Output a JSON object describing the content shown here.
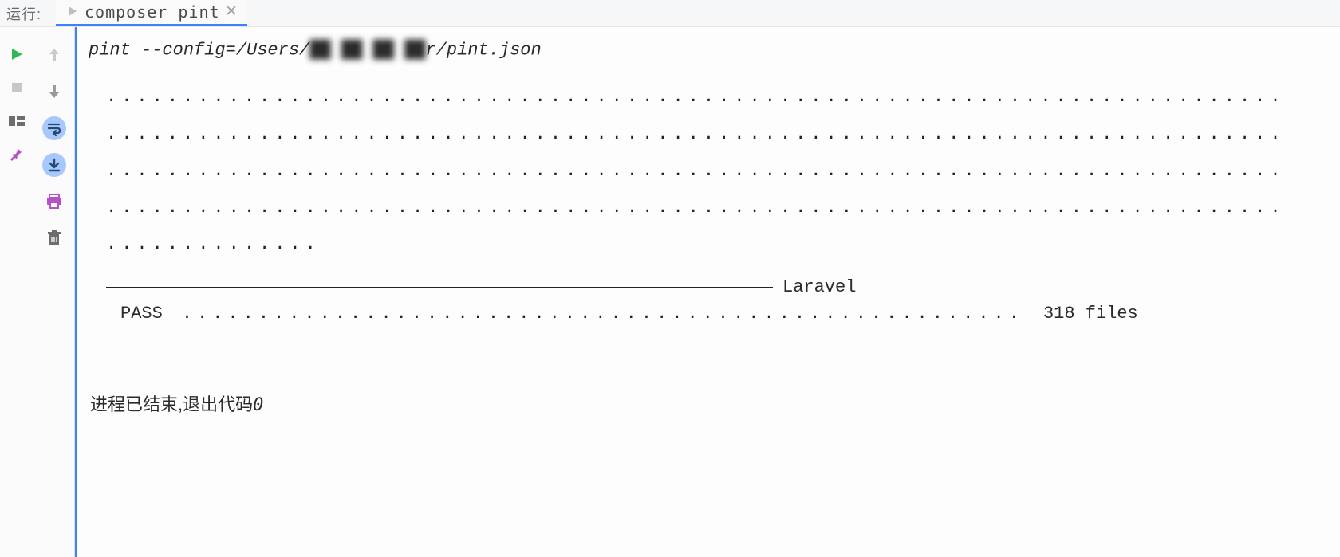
{
  "tabstrip": {
    "panel_label": "运行:",
    "tab": {
      "name": "composer pint"
    }
  },
  "icons": {
    "run": "run-icon",
    "stop": "stop-icon",
    "layout": "layout-icon",
    "pin": "pin-icon",
    "up": "arrow-up-icon",
    "down": "arrow-down-icon",
    "wrap": "soft-wrap-icon",
    "scroll_end": "scroll-to-end-icon",
    "print": "print-icon",
    "trash": "trash-icon"
  },
  "console": {
    "command_prefix": "pint --config=/Users/",
    "command_redacted": "██ ██  ██  ██ ",
    "command_suffix": "r/pint.json",
    "dots_line1": ".............................................................................",
    "dots_line2": ".............................................................................",
    "dots_line3": ".............................................................................",
    "dots_line4": ".............................................................................",
    "dots_line5": "..............",
    "rule_label": "Laravel",
    "pass_label": "PASS",
    "pass_dots": ".......................................................",
    "pass_count": "318 files",
    "exit_text": "进程已结束,退出代码",
    "exit_code": "0"
  }
}
